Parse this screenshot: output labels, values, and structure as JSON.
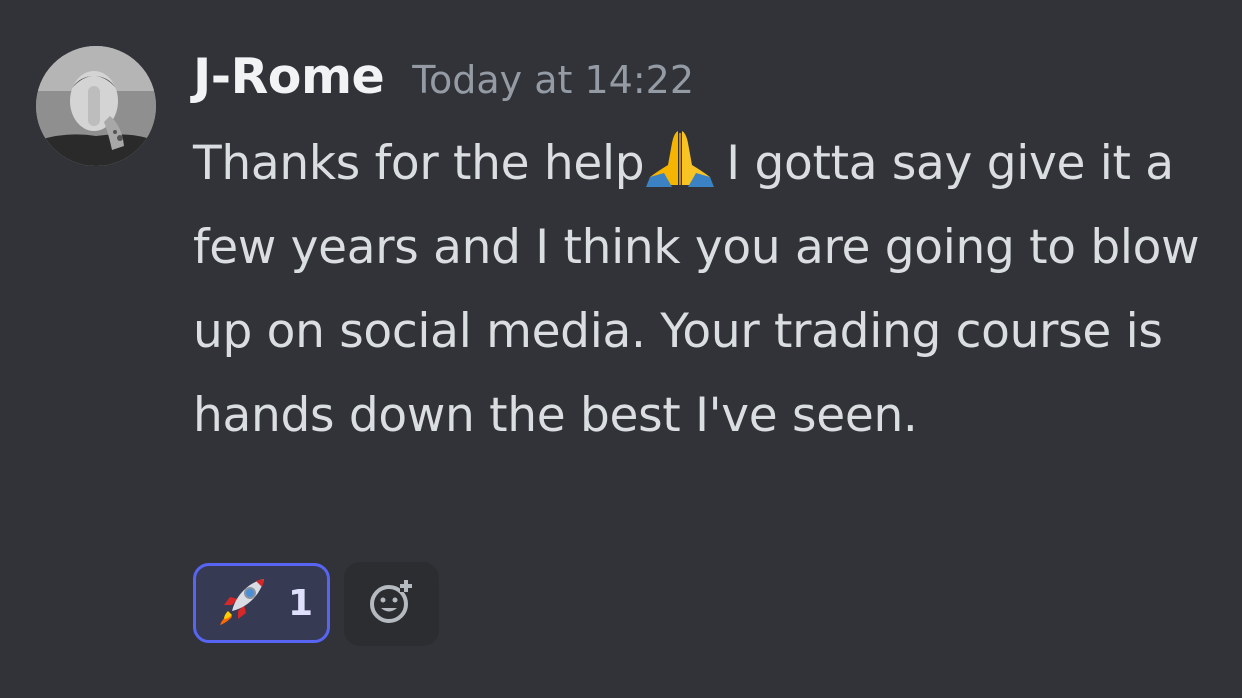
{
  "message": {
    "author": "J-Rome",
    "timestamp": "Today at 14:22",
    "text_part1": "Thanks for the help",
    "inline_emoji": "folded-hands",
    "text_part2": "I gotta say give it a few years and I think you are going to blow up on social media. Your trading course is hands down the best I've seen."
  },
  "reactions": [
    {
      "emoji": "rocket",
      "count": "1",
      "active": true
    }
  ],
  "add_reaction": {
    "icon": "add-reaction-icon"
  },
  "colors": {
    "background": "#313338",
    "username": "#f2f3f5",
    "timestamp": "#949ba4",
    "text": "#dbdee1",
    "reaction_border": "#5865f2",
    "reaction_bg": "#373a53"
  }
}
